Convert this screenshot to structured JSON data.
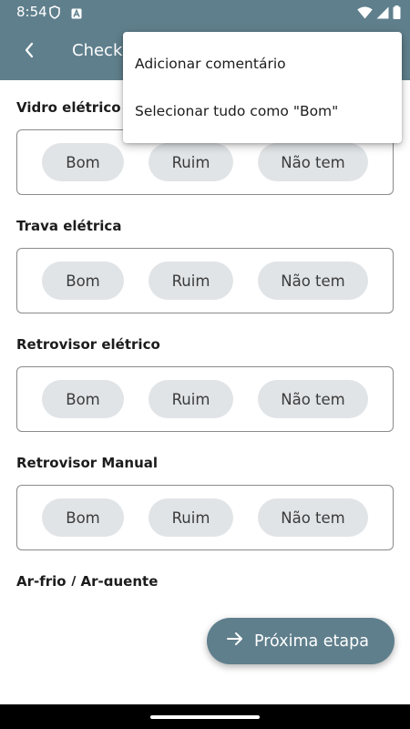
{
  "status_bar": {
    "time": "8:54",
    "icons": [
      "shield-icon",
      "notification-a-icon",
      "wifi-icon",
      "signal-icon",
      "battery-icon"
    ]
  },
  "app_bar": {
    "title": "Checkl",
    "back_icon": "back-chevron-icon"
  },
  "menu": {
    "items": [
      {
        "label": "Adicionar comentário"
      },
      {
        "label": "Selecionar tudo como \"Bom\""
      }
    ]
  },
  "sections": [
    {
      "title": "Vidro elétrico",
      "options": [
        "Bom",
        "Ruim",
        "Não tem"
      ]
    },
    {
      "title": "Trava elétrica",
      "options": [
        "Bom",
        "Ruim",
        "Não tem"
      ]
    },
    {
      "title": "Retrovisor elétrico",
      "options": [
        "Bom",
        "Ruim",
        "Não tem"
      ]
    },
    {
      "title": "Retrovisor Manual",
      "options": [
        "Bom",
        "Ruim",
        "Não tem"
      ]
    },
    {
      "title": "Ar-frio / Ar-quente"
    }
  ],
  "fab": {
    "label": "Próxima etapa",
    "icon": "arrow-right-icon"
  },
  "colors": {
    "primary": "#5f7f8c",
    "chip_bg": "#e1e4e7",
    "box_border": "#8a8a8a"
  }
}
